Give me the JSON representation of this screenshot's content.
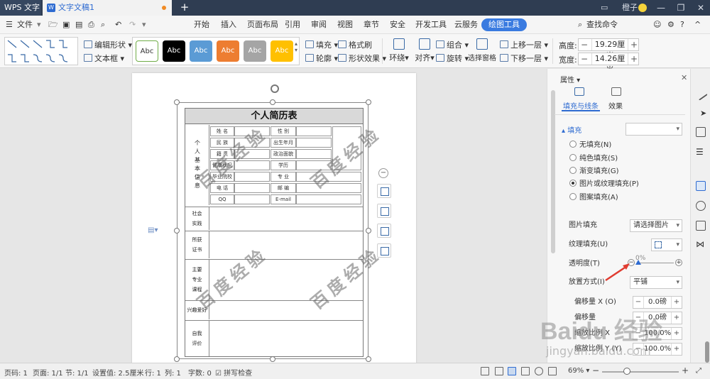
{
  "titlebar": {
    "app_name": "WPS 文字",
    "doc_tab": "文字文稿1",
    "new_tab": "+",
    "user": "橙子"
  },
  "menu": {
    "file": "文件",
    "items": [
      "开始",
      "插入",
      "页面布局",
      "引用",
      "审阅",
      "视图",
      "章节",
      "安全",
      "开发工具",
      "云服务",
      "绘图工具"
    ],
    "search": "查找命令"
  },
  "ribbon": {
    "edit_shape": "编辑形状",
    "text_box": "文本框",
    "style_swatches": [
      "Abc",
      "Abc",
      "Abc",
      "Abc",
      "Abc",
      "Abc"
    ],
    "swatch_colors": [
      "#ffffff",
      "#000000",
      "#5b9bd5",
      "#ed7d31",
      "#a5a5a5",
      "#ffc000"
    ],
    "fill": "填充",
    "outline": "轮廓",
    "format_painter": "格式刷",
    "shape_effects": "形状效果",
    "wrap": "环绕",
    "align": "对齐",
    "group": "组合",
    "rotate": "旋转",
    "selection_pane": "选择窗格",
    "bring_forward": "上移一层",
    "send_backward": "下移一层",
    "height_label": "高度:",
    "height_value": "19.29厘米",
    "width_label": "宽度:",
    "width_value": "14.26厘米"
  },
  "resume": {
    "title": "个人简历表",
    "basic_info_label": "个人基本信息",
    "fields_left": [
      "姓 名",
      "民 族",
      "籍 贯",
      "健康状况",
      "毕业院校",
      "电 话",
      "QQ"
    ],
    "fields_right": [
      "性 别",
      "出生年月",
      "政治面貌",
      "学历",
      "专 业",
      "邮 编",
      "E-mail"
    ],
    "sections": [
      "社会实践",
      "所获证书",
      "主要专业课程",
      "兴趣爱好",
      "自我评价"
    ],
    "watermark": "百度经验"
  },
  "panel": {
    "title": "属性",
    "tab_fill": "填充与线条",
    "tab_effect": "效果",
    "fill_header": "填充",
    "radios": [
      "无填充(N)",
      "纯色填充(S)",
      "渐变填充(G)",
      "图片或纹理填充(P)",
      "图案填充(A)"
    ],
    "selected_radio": 3,
    "picture_fill_label": "图片填充",
    "picture_fill_value": "请选择图片",
    "texture_fill_label": "纹理填充(U)",
    "transparency_label": "透明度(T)",
    "transparency_value": "0%",
    "placement_label": "放置方式(I)",
    "placement_value": "平铺",
    "offset_x_label": "偏移量 X (O)",
    "offset_x_value": "0.0磅",
    "offset_y_label": "偏移量",
    "offset_y_value": "0.0磅",
    "scale_x_label": "缩放比例 X",
    "scale_x_value": "100.0%",
    "scale_y_label": "缩放比例 Y (Y)",
    "scale_y_value": "100.0%"
  },
  "status": {
    "page_num": "页码: 1",
    "pages": "页面: 1/1",
    "section": "节: 1/1",
    "setting": "设置值: 2.5厘米",
    "row": "行: 1",
    "col": "列: 1",
    "word_count": "字数: 0",
    "spell_check": "拼写检查",
    "zoom": "69%",
    "zoom_level": 0.69
  },
  "watermark_site": "Baidu 经验",
  "watermark_url": "jingyan.baidu.com"
}
